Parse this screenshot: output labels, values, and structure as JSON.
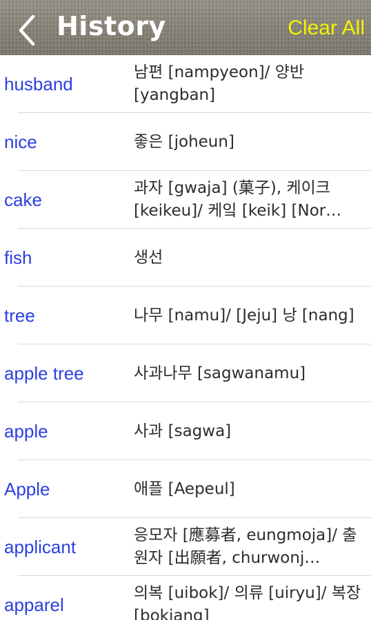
{
  "nav": {
    "title": "History",
    "clear_label": "Clear All",
    "back_icon": "chevron-left-icon"
  },
  "colors": {
    "word_link": "#2b3fe0",
    "clear_button": "#f6f200",
    "title": "#ffffff"
  },
  "history": [
    {
      "word": "husband",
      "definition": "남편 [nampyeon]/ 양반 [yangban]"
    },
    {
      "word": "nice",
      "definition": "좋은 [joheun]"
    },
    {
      "word": "cake",
      "definition": "과자 [gwaja] (菓子), 케이크 [keikeu]/ 케잌 [keik] [Nor…"
    },
    {
      "word": "fish",
      "definition": "생선"
    },
    {
      "word": "tree",
      "definition": "나무 [namu]/ [Jeju] 낭 [nang]"
    },
    {
      "word": "apple tree",
      "definition": "사과나무 [sagwanamu]"
    },
    {
      "word": "apple",
      "definition": "사과 [sagwa]"
    },
    {
      "word": "Apple",
      "definition": "애플 [Aepeul]"
    },
    {
      "word": "applicant",
      "definition": "응모자 [應募者, eungmoja]/ 출원자 [出願者, churwonj…"
    },
    {
      "word": "apparel",
      "definition": "의복 [uibok]/ 의류 [uiryu]/ 복장 [bokjang]"
    }
  ]
}
